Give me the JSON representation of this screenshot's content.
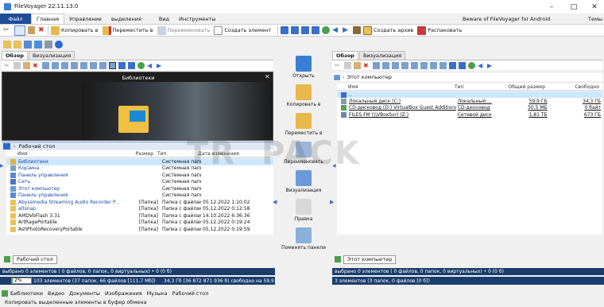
{
  "window": {
    "title": "FileVoyager 22.11.13.0",
    "minimize": "–",
    "maximize": "□",
    "close": "✕"
  },
  "menu": {
    "file": "Файл",
    "tabs": [
      "Главная",
      "Управление",
      "выделения",
      "Вид",
      "Инструменты"
    ],
    "beware": "Beware of FileVoyager for Android",
    "themes": "Темы"
  },
  "ribbon": {
    "copy_to": "Копировать в",
    "move_to": "Переместить в",
    "rename": "Переименовать",
    "create_item": "Создать элемент",
    "create_archive": "Создать архив",
    "extract": "Распаковать"
  },
  "left": {
    "tabs": [
      "Обзор",
      "Визуализация"
    ],
    "preview_title": "Библиотеки",
    "path": "Рабочий стол",
    "columns": {
      "name": "Имя",
      "size": "Размер",
      "type": "Тип",
      "date": "Дата изменения"
    },
    "rows": [
      {
        "name": "Библиотеки",
        "size": "",
        "type": "Системная папка",
        "date": "",
        "icon": "library-icon",
        "color": "#d9b14a"
      },
      {
        "name": "Корзина",
        "size": "",
        "type": "Системная папка",
        "date": "",
        "icon": "recycle-bin-icon",
        "color": "#7aa0c8"
      },
      {
        "name": "Панель управления",
        "size": "",
        "type": "Системная папка",
        "date": "",
        "icon": "control-panel-icon",
        "color": "#5a8ad0"
      },
      {
        "name": "Сеть",
        "size": "",
        "type": "Системная папка",
        "date": "",
        "icon": "network-icon",
        "color": "#4a78c0"
      },
      {
        "name": "Этот компьютер",
        "size": "",
        "type": "Системная папка",
        "date": "",
        "icon": "computer-icon",
        "color": "#6b9ad8"
      },
      {
        "name": "Панель управления",
        "size": "",
        "type": "Системная папка",
        "date": "",
        "icon": "control-panel-icon",
        "color": "#5a8ad0"
      },
      {
        "name": "Abyssmedia Streaming Audio Recorder P...",
        "size": "[Папка]",
        "type": "Папка с файлами",
        "date": "05.12.2022 1:10:02",
        "icon": "folder-icon",
        "color": "#e8c25a"
      },
      {
        "name": "altsnap",
        "size": "[Папка]",
        "type": "Папка с файлами",
        "date": "05.12.2022 0:12:58",
        "icon": "folder-icon",
        "color": "#e8c25a"
      },
      {
        "name": "AMDVbFlash 3.31",
        "size": "[Папка]",
        "type": "Папка с файлами",
        "date": "14.10.2022 6:36:36",
        "icon": "folder-icon",
        "color": "#e8c25a"
      },
      {
        "name": "ArtRagePortable",
        "size": "[Папка]",
        "type": "Папка с файлами",
        "date": "05.12.2022 0:19:24",
        "icon": "folder-icon",
        "color": "#e8c25a"
      },
      {
        "name": "AshPhotoRecoveryPortable",
        "size": "[Папка]",
        "type": "Папка с файлами",
        "date": "05.12.2022 0:19:59",
        "icon": "folder-icon",
        "color": "#e8c25a"
      }
    ],
    "bottom_tab": "Рабочий стол",
    "selected_status": "выбрано 0 элементов ( 0 файлов, 0 папок, 0 виртуальных) • 0 (0 б)",
    "usage_percent": "2%",
    "usage_fraction": 0.02,
    "items_status": "103 элементов (37 папок, 66 файлов [111,7 Мб])",
    "free_status": "34,3 Гб (36 872 871 936 б) свободно на 59,9 Гб"
  },
  "middle": {
    "buttons": [
      {
        "label": "Открыть",
        "icon": "open-gear-icon",
        "color": "#3a7fd6"
      },
      {
        "label": "Копировать в",
        "icon": "copy-folder-icon",
        "color": "#e8b84a"
      },
      {
        "label": "Переместить в",
        "icon": "move-folder-icon",
        "color": "#e8b84a"
      },
      {
        "label": "Переименовать",
        "icon": "rename-ab-icon",
        "color": "#9bb6d8"
      },
      {
        "label": "Визуализация",
        "icon": "visualize-icon",
        "color": "#6a9ad8"
      },
      {
        "label": "Правка",
        "icon": "edit-icon",
        "color": "#d8d8d8"
      },
      {
        "label": "Поменять панели",
        "icon": "swap-panels-icon",
        "color": "#8ab0dc"
      }
    ]
  },
  "right": {
    "tabs": [
      "Обзор",
      "Визуализация"
    ],
    "path": "Этот компьютер",
    "columns": {
      "name": "Имя",
      "type": "Тип",
      "total": "Общий размер",
      "free": "Свободно"
    },
    "up_row": "..",
    "rows": [
      {
        "name": "Локальный диск (C:)",
        "type": "Локальный ...",
        "total": "59,9 ГБ",
        "free": "34,3 ГБ",
        "icon": "local-disk-icon",
        "color": "#8a9aa8"
      },
      {
        "name": "CD-дисковод (D:) VirtualBox Guest Additions",
        "type": "CD-дисковод",
        "total": "50,5 МБ",
        "free": "0 байт",
        "icon": "cd-drive-icon",
        "color": "#5aa05a"
      },
      {
        "name": "FILES.FM (\\\\VBoxSvr) (Z:)",
        "type": "Сетевой диск",
        "total": "1,81 ТБ",
        "free": "673 ГБ",
        "icon": "network-drive-icon",
        "color": "#6a8aa8"
      }
    ],
    "bottom_tab": "Этот компьютер",
    "selected_status": "выбрано 0 элементов ( 0 файлов, 0 папок, 0 виртуальных) • 0 (0 б)",
    "items_status": "3 элементов (3 папок, 0 файлов [0 б])"
  },
  "bottom": {
    "quick_links": [
      "Библиотеки",
      "Видео",
      "Документы",
      "Изображения",
      "Музыка",
      "Рабочий стол"
    ],
    "hint": "Копировать выделенные элементы в буфер обмена"
  },
  "watermark": "TR  PACK",
  "colors": {
    "accent": "#1f4e98",
    "status_bar": "#1b3d6e",
    "selection": "#cce8ff"
  }
}
